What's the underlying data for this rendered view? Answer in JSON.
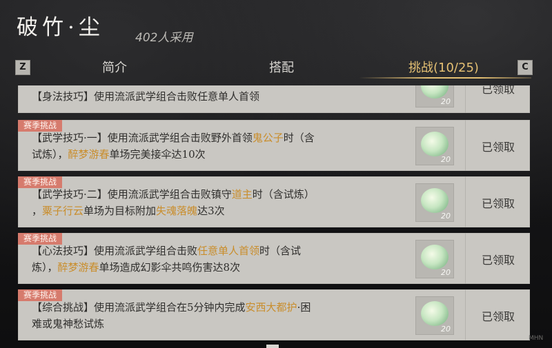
{
  "header": {
    "title": "破竹·尘",
    "adopt_count": "402人采用"
  },
  "tabs": {
    "key_left": "Z",
    "key_right": "C",
    "items": [
      {
        "label": "简介"
      },
      {
        "label": "搭配"
      },
      {
        "label": "挑战(10/25)"
      }
    ]
  },
  "cards": [
    {
      "clipped_text": "【身法技巧】使用流派武学组合击败任意单人首领",
      "reward_count": "20",
      "status": "已领取"
    },
    {
      "badge": "赛季挑战",
      "segments": [
        "【武学技巧·一】使用流派武学组合击败野外首领",
        "鬼公子",
        "时（含",
        "试炼），",
        "醉梦游春",
        "单场完美接伞达10次"
      ],
      "reward_count": "20",
      "status": "已领取"
    },
    {
      "badge": "赛季挑战",
      "segments": [
        "【武学技巧·二】使用流派武学组合击败镇守",
        "道主",
        "时（含试炼）",
        "，",
        "粟子行云",
        "单场为目标附加",
        "失魂落魄",
        "达3次"
      ],
      "reward_count": "20",
      "status": "已领取"
    },
    {
      "badge": "赛季挑战",
      "segments": [
        "【心法技巧】使用流派武学组合击败",
        "任意单人首领",
        "时（含试",
        "炼），",
        "醉梦游春",
        "单场造成幻影伞共鸣伤害达8次"
      ],
      "reward_count": "20",
      "status": "已领取"
    },
    {
      "badge": "赛季挑战",
      "segments": [
        "【综合挑战】使用流派武学组合在5分钟内完成",
        "安西大都护",
        "·困",
        "难或鬼神愁试炼"
      ],
      "reward_count": "20",
      "status": "已领取"
    }
  ],
  "watermark": "MHN",
  "colors": {
    "accent_gold": "#e5c073",
    "highlight": "#c98d2b",
    "badge_red": "#d67b6d",
    "card_bg": "#c9c7c2"
  }
}
